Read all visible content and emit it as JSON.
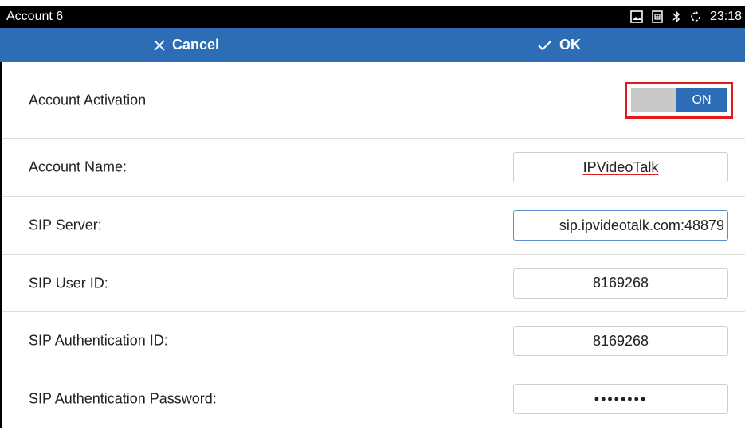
{
  "statusbar": {
    "title": "Account 6",
    "time": "23:18",
    "icons": [
      "gallery-icon",
      "sim-card-icon",
      "bluetooth-icon",
      "sync-icon"
    ]
  },
  "actionbar": {
    "cancel_label": "Cancel",
    "cancel_icon": "close-icon",
    "ok_label": "OK",
    "ok_icon": "check-icon"
  },
  "form": {
    "activation": {
      "label": "Account Activation",
      "toggle_state": "ON"
    },
    "account_name": {
      "label": "Account Name:",
      "value": "IPVideoTalk"
    },
    "sip_server": {
      "label": "SIP Server:",
      "value_prefix": "sip.ipvideotalk.com",
      "value_suffix": ":48879"
    },
    "sip_user_id": {
      "label": "SIP User ID:",
      "value": "8169268"
    },
    "sip_auth_id": {
      "label": "SIP Authentication ID:",
      "value": "8169268"
    },
    "sip_auth_password": {
      "label": "SIP Authentication Password:",
      "value": "••••••••"
    }
  },
  "colors": {
    "accent": "#2d6db5",
    "highlight": "#e01b1b",
    "statusbar": "#000000"
  }
}
